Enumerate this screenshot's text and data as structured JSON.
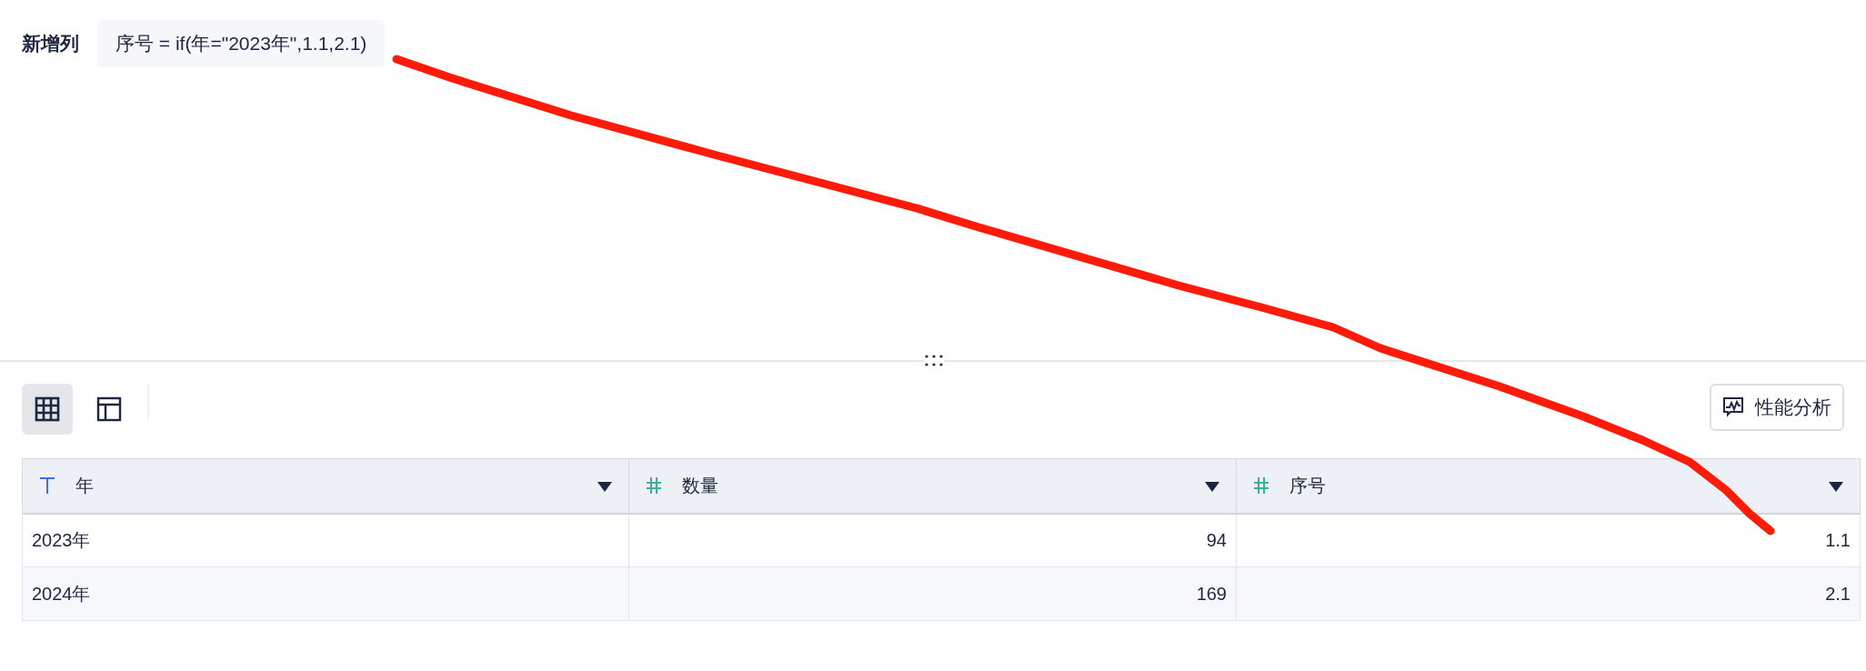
{
  "formula": {
    "label": "新增列",
    "expression": "序号 = if(年=\"2023年\",1.1,2.1)"
  },
  "toolbar": {
    "views": [
      {
        "kind": "grid",
        "selected": true
      },
      {
        "kind": "layout",
        "selected": false
      }
    ],
    "analyze_button": "性能分析"
  },
  "table": {
    "columns": [
      {
        "name": "年",
        "kind": "text"
      },
      {
        "name": "数量",
        "kind": "number"
      },
      {
        "name": "序号",
        "kind": "number"
      }
    ],
    "rows": [
      [
        "2023年",
        "94",
        "1.1"
      ],
      [
        "2024年",
        "169",
        "2.1"
      ]
    ]
  }
}
